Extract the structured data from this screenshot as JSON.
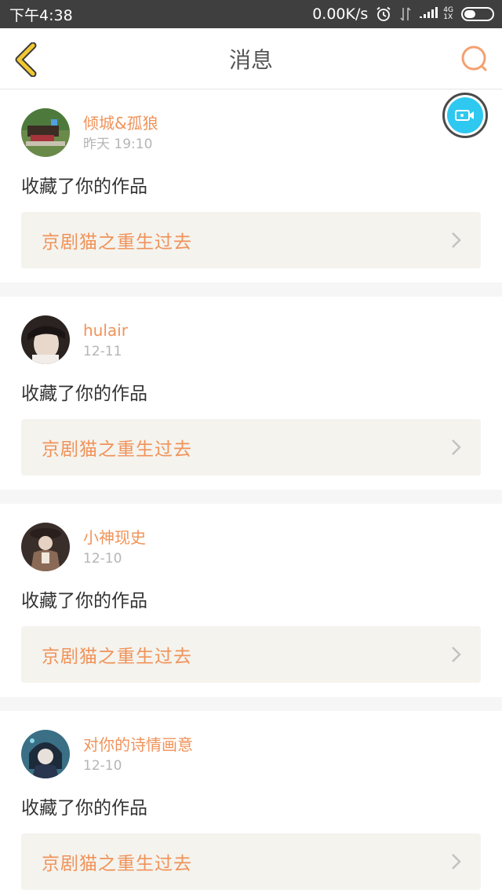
{
  "status_bar": {
    "time": "下午4:38",
    "speed": "0.00K/s",
    "net_top": "4G",
    "net_bottom": "1X",
    "icons": [
      "alarm-icon",
      "data-transfer-icon",
      "signal-icon",
      "signal-icon",
      "battery-icon"
    ]
  },
  "header": {
    "title": "消息",
    "back_icon": "chevron-left-icon",
    "search_icon": "search-icon"
  },
  "fab": {
    "icon": "video-camera-icon",
    "color": "#2ec8f0"
  },
  "messages": [
    {
      "user": "倾城&孤狼",
      "time": "昨天 19:10",
      "action": "收藏了你的作品",
      "work": "京剧猫之重生过去"
    },
    {
      "user": "hulair",
      "time": "12-11",
      "action": "收藏了你的作品",
      "work": "京剧猫之重生过去"
    },
    {
      "user": "小神现史",
      "time": "12-10",
      "action": "收藏了你的作品",
      "work": "京剧猫之重生过去"
    },
    {
      "user": "对你的诗情画意",
      "time": "12-10",
      "action": "收藏了你的作品",
      "work": "京剧猫之重生过去"
    }
  ],
  "colors": {
    "accent": "#f0935a",
    "status_bar": "#3f3f3f",
    "back_icon": "#f2c832",
    "work_box": "#f4f3ee"
  }
}
